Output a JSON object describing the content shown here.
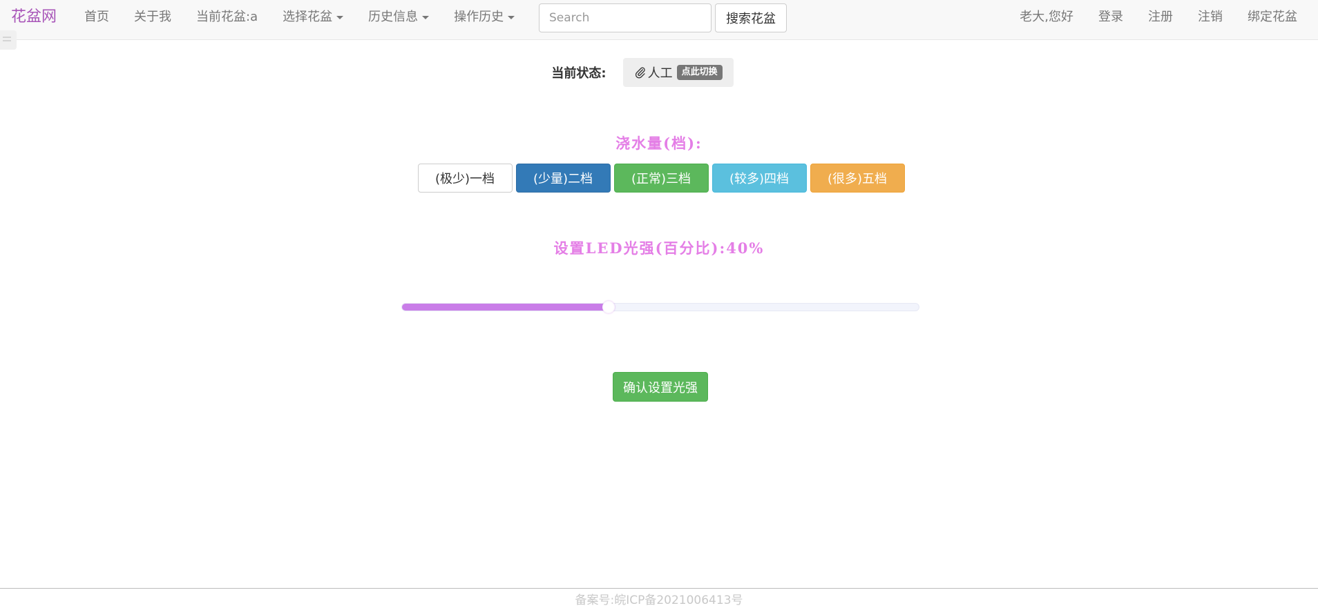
{
  "navbar": {
    "brand": "花盆网",
    "items": [
      {
        "label": "首页"
      },
      {
        "label": "关于我"
      },
      {
        "label": "当前花盆:a"
      },
      {
        "label": "选择花盆"
      },
      {
        "label": "历史信息"
      },
      {
        "label": "操作历史"
      }
    ],
    "search": {
      "placeholder": "Search",
      "value": "",
      "button_label": "搜索花盆"
    },
    "right_items": [
      {
        "label": "老大,您好"
      },
      {
        "label": "登录"
      },
      {
        "label": "注册"
      },
      {
        "label": "注销"
      },
      {
        "label": "绑定花盆"
      }
    ]
  },
  "status": {
    "label": "当前状态:",
    "mode": "人工",
    "switch_badge": "点此切换"
  },
  "water": {
    "title": "浇水量(档):",
    "levels": [
      {
        "label": "(极少)一档",
        "color": "#ffffff"
      },
      {
        "label": "(少量)二档",
        "color": "#337ab7"
      },
      {
        "label": "(正常)三档",
        "color": "#5cb85c"
      },
      {
        "label": "(较多)四档",
        "color": "#5bc0de"
      },
      {
        "label": "(很多)五档",
        "color": "#f0ad4e"
      }
    ]
  },
  "led": {
    "title": "设置LED光强(百分比):40%",
    "value_percent": 40,
    "fill_color": "#c97de8",
    "confirm_label": "确认设置光强"
  },
  "footer": {
    "text": "备案号:皖ICP备2021006413号"
  },
  "colors": {
    "brand": "#a855b8",
    "title_accent": "#e47ee6"
  }
}
